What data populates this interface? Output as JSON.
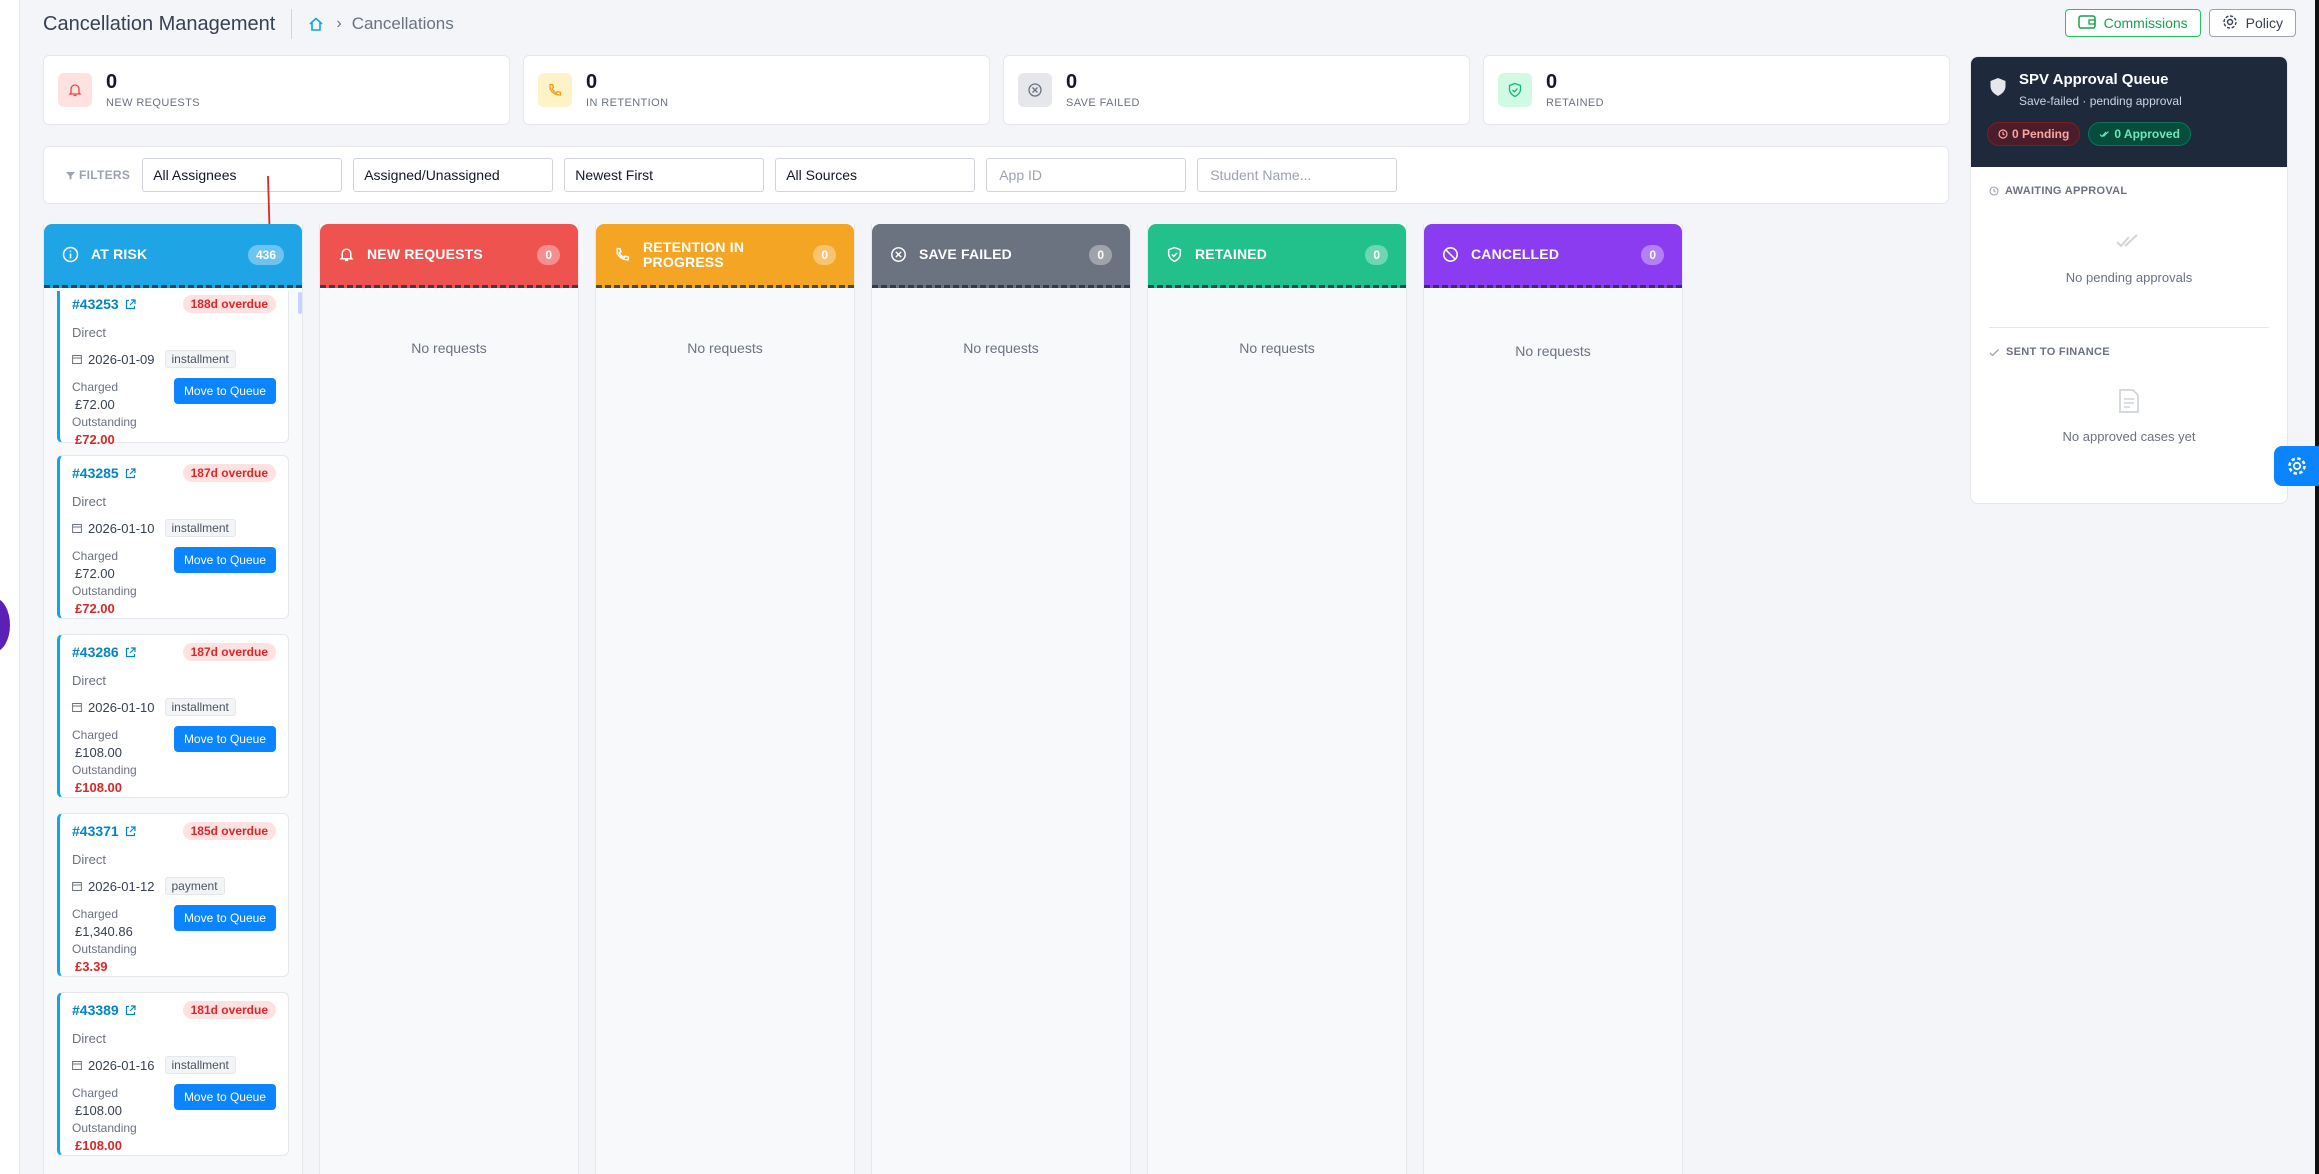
{
  "header": {
    "title": "Cancellation Management",
    "breadcrumb": "Cancellations",
    "commissions_label": "Commissions",
    "policy_label": "Policy"
  },
  "stats": [
    {
      "value": "0",
      "label": "NEW REQUESTS",
      "color": "#ef4444",
      "bg": "#fee2e2",
      "icon": "bell-icon"
    },
    {
      "value": "0",
      "label": "IN RETENTION",
      "color": "#f59e0b",
      "bg": "#fef3c7",
      "icon": "phone-icon"
    },
    {
      "value": "0",
      "label": "SAVE FAILED",
      "color": "#6b7280",
      "bg": "#e5e7eb",
      "icon": "x-circle-icon"
    },
    {
      "value": "0",
      "label": "RETAINED",
      "color": "#10b981",
      "bg": "#d1fae5",
      "icon": "shield-check-icon"
    }
  ],
  "filters": {
    "label": "FILTERS",
    "assignees": "All Assignees",
    "assigned": "Assigned/Unassigned",
    "sort": "Newest First",
    "sources": "All Sources",
    "app_id_placeholder": "App ID",
    "student_placeholder": "Student Name..."
  },
  "columns": [
    {
      "title": "AT RISK",
      "count": "436",
      "color": "#1fa5e6",
      "icon": "info-icon"
    },
    {
      "title": "NEW REQUESTS",
      "count": "0",
      "color": "#ef5350",
      "icon": "bell-icon",
      "empty": "No requests"
    },
    {
      "title": "RETENTION IN PROGRESS",
      "count": "0",
      "color": "#f5a524",
      "icon": "phone-icon",
      "empty": "No requests"
    },
    {
      "title": "SAVE FAILED",
      "count": "0",
      "color": "#6b7280",
      "icon": "x-circle-icon",
      "empty": "No requests"
    },
    {
      "title": "RETAINED",
      "count": "0",
      "color": "#22c08a",
      "icon": "shield-check-icon",
      "empty": "No requests"
    },
    {
      "title": "CANCELLED",
      "count": "0",
      "color": "#8b3cf0",
      "icon": "ban-icon",
      "empty": "No requests"
    }
  ],
  "cards": [
    {
      "id": "#43253",
      "overdue": "188d overdue",
      "source": "Direct",
      "date": "2026-01-09",
      "type": "installment",
      "charged_label": "Charged",
      "charged": "£72.00",
      "outstanding_label": "Outstanding",
      "outstanding": "£72.00",
      "button": "Move to Queue"
    },
    {
      "id": "#43285",
      "overdue": "187d overdue",
      "source": "Direct",
      "date": "2026-01-10",
      "type": "installment",
      "charged_label": "Charged",
      "charged": "£72.00",
      "outstanding_label": "Outstanding",
      "outstanding": "£72.00",
      "button": "Move to Queue"
    },
    {
      "id": "#43286",
      "overdue": "187d overdue",
      "source": "Direct",
      "date": "2026-01-10",
      "type": "installment",
      "charged_label": "Charged",
      "charged": "£108.00",
      "outstanding_label": "Outstanding",
      "outstanding": "£108.00",
      "button": "Move to Queue"
    },
    {
      "id": "#43371",
      "overdue": "185d overdue",
      "source": "Direct",
      "date": "2026-01-12",
      "type": "payment",
      "charged_label": "Charged",
      "charged": "£1,340.86",
      "outstanding_label": "Outstanding",
      "outstanding": "£3.39",
      "button": "Move to Queue"
    },
    {
      "id": "#43389",
      "overdue": "181d overdue",
      "source": "Direct",
      "date": "2026-01-16",
      "type": "installment",
      "charged_label": "Charged",
      "charged": "£108.00",
      "outstanding_label": "Outstanding",
      "outstanding": "£108.00",
      "button": "Move to Queue"
    }
  ],
  "spv": {
    "title": "SPV Approval Queue",
    "subtitle": "Save-failed · pending approval",
    "pending": "0 Pending",
    "approved": "0 Approved",
    "awaiting_label": "AWAITING APPROVAL",
    "awaiting_empty": "No pending approvals",
    "finance_label": "SENT TO FINANCE",
    "finance_empty": "No approved cases yet"
  }
}
